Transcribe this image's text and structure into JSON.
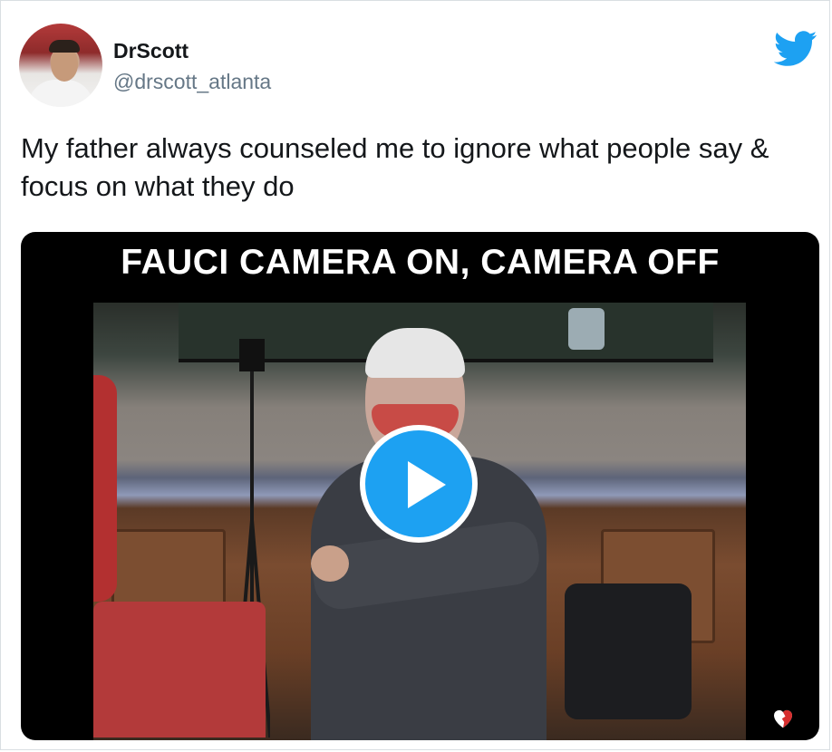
{
  "tweet": {
    "author": {
      "display_name": "DrScott",
      "handle": "@drscott_atlanta",
      "avatar_icon": "profile-photo-icon"
    },
    "body": "My father always counseled me to ignore what people say & focus on what they do",
    "media": {
      "caption_overlay": "FAUCI CAMERA ON, CAMERA OFF",
      "play_icon": "play-icon",
      "corner_icon": "broken-heart-icon"
    },
    "brand_icon": "twitter-bird-icon"
  },
  "colors": {
    "twitter_blue": "#1da1f2",
    "text_primary": "#14171a",
    "text_secondary": "#657786",
    "border": "#d9dee2",
    "video_bg": "#000000"
  }
}
